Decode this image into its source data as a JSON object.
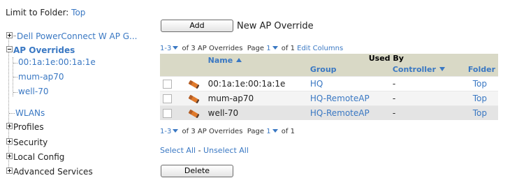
{
  "folder": {
    "label": "Limit to Folder:",
    "value": "Top"
  },
  "tree": {
    "dell": "Dell PowerConnect W AP G...",
    "ap_overrides": "AP Overrides",
    "children": [
      "00:1a:1e:00:1a:1e",
      "mum-ap70",
      "well-70"
    ],
    "wlans": "WLANs",
    "profiles": "Profiles",
    "security": "Security",
    "local_config": "Local Config",
    "advanced_services": "Advanced Services"
  },
  "toolbar": {
    "add_label": "Add",
    "new_override_label": "New AP Override",
    "delete_label": "Delete"
  },
  "pager_top": {
    "range": "1-3",
    "count_text": "of 3 AP Overrides",
    "page_text": "Page",
    "page": "1",
    "of_text": "of 1",
    "edit_columns": "Edit Columns"
  },
  "pager_bottom": {
    "range": "1-3",
    "count_text": "of 3 AP Overrides",
    "page_text": "Page",
    "page": "1",
    "of_text": "of 1"
  },
  "table": {
    "used_by": "Used By",
    "col_name": "Name",
    "col_group": "Group",
    "col_controller": "Controller",
    "col_folder": "Folder",
    "rows": [
      {
        "name": "00:1a:1e:00:1a:1e",
        "group": "HQ",
        "controller": "-",
        "folder": "Top"
      },
      {
        "name": "mum-ap70",
        "group": "HQ-RemoteAP",
        "controller": "-",
        "folder": "Top"
      },
      {
        "name": "well-70",
        "group": "HQ-RemoteAP",
        "controller": "-",
        "folder": "Top"
      }
    ]
  },
  "selection": {
    "select_all": "Select All",
    "separator": " - ",
    "unselect_all": "Unselect All"
  },
  "colors": {
    "link": "#3a78c3",
    "header_bg": "#d9d9c6"
  }
}
